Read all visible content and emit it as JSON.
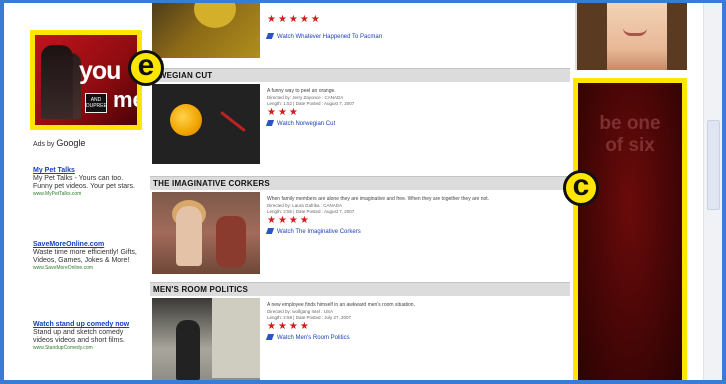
{
  "ads": {
    "poster_text_1": "you",
    "poster_text_2": "me",
    "poster_text_3": "AND DUPREE",
    "ads_by_google_prefix": "Ads by",
    "ads_by_google_brand": "Google",
    "text_ads": [
      {
        "title": "My Pet Talks",
        "body": "My Pet Talks - Yours can too. Funny pet videos. Your pet stars.",
        "url": "www.MyPetTalks.com"
      },
      {
        "title": "SaveMoreOnline.com",
        "body": "Waste time more efficiently! Gifts, Videos, Games, Jokes & More!",
        "url": "www.SaveMoreOnline.com"
      },
      {
        "title": "Watch stand up comedy now",
        "body": "Stand up and sketch comedy videos videos and short films.",
        "url": "www.StandupComedy.com"
      }
    ]
  },
  "videos": [
    {
      "title": "",
      "description": "",
      "meta_directed": "",
      "meta_length": "",
      "rating_stars": "★★★★★",
      "watch_label": "Watch Whatever Happened To Pacman"
    },
    {
      "title": "NORWEGIAN CUT",
      "title_visible": "RWEGIAN CUT",
      "description": "A funny way to peel an orange.",
      "meta_directed": "Directed by: Jerry Zayonce : CANADA",
      "meta_length": "Length: 1:52 | Date Posted : August 7, 2007",
      "rating_stars": "★★★",
      "watch_label": "Watch Norwegian Cut"
    },
    {
      "title": "THE IMAGINATIVE CORKERS",
      "description": "When family members are alone they are imaginative and free. When they are together they are not.",
      "meta_directed": "Directed by: Laura Gafrika : CANADA",
      "meta_length": "Length: 2:55 | Date Posted : August 7, 2007",
      "rating_stars": "★★★★",
      "watch_label": "Watch The Imaginative Corkers"
    },
    {
      "title": "MEN'S ROOM POLITICS",
      "description": "A new employee finds himself in an awkward men's room situation.",
      "meta_directed": "Directed by: wolfgang Intel : USA",
      "meta_length": "Length: 2:58 | Date Posted : July 27, 2007",
      "rating_stars": "★★★★",
      "watch_label": "Watch Men's Room Politics"
    }
  ],
  "banner": {
    "line1": "be one",
    "line2": "of six"
  },
  "callouts": {
    "left": "e",
    "right": "c"
  },
  "colors": {
    "highlight_yellow": "#ffe600",
    "frame_blue": "#3a7bd5",
    "star_red": "#d11d1d",
    "link_blue": "#1a3fb8",
    "banner_red": "#4a0606"
  }
}
